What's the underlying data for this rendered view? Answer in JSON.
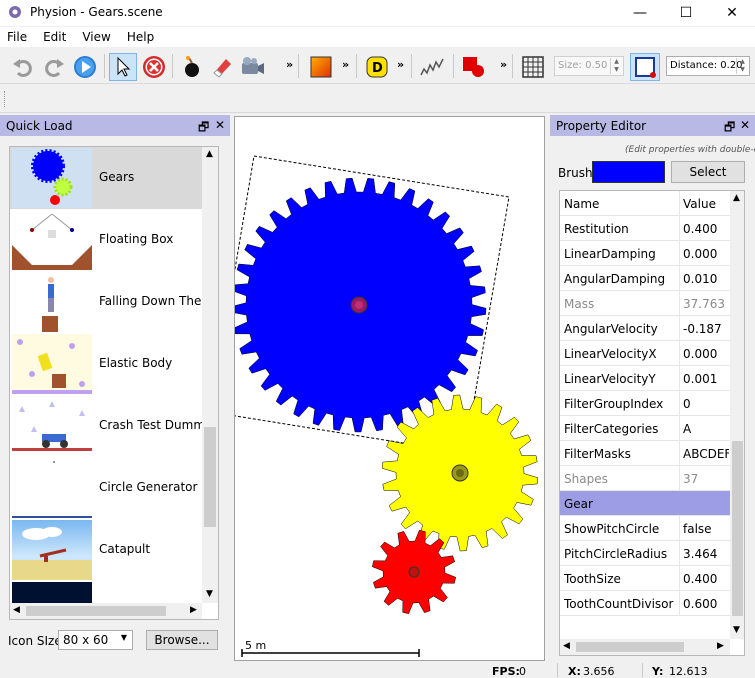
{
  "window": {
    "title": "Physion - Gears.scene",
    "minimize": "—",
    "maximize": "☐",
    "close": "✕"
  },
  "menu": [
    "File",
    "Edit",
    "View",
    "Help"
  ],
  "toolbar": {
    "size_label": "Size: 0.50",
    "distance_label": "Distance: 0.20",
    "chevron": "»"
  },
  "quick_load": {
    "title": "Quick Load",
    "float": "🗗",
    "close": "✕",
    "items": [
      {
        "label": "Gears",
        "selected": true
      },
      {
        "label": "Floating Box"
      },
      {
        "label": "Falling Down The St"
      },
      {
        "label": "Elastic Body"
      },
      {
        "label": "Crash Test Dummy"
      },
      {
        "label": "Circle Generator"
      },
      {
        "label": "Catapult"
      }
    ],
    "icon_size_label": "Icon SIze",
    "icon_size_value": "80 x 60",
    "browse_label": "Browse..."
  },
  "scene": {
    "scale_label": "5 m"
  },
  "property_editor": {
    "title": "Property Editor",
    "hint": "(Edit properties with double-click)",
    "brush_label": "Brush",
    "brush_color": "#0000ff",
    "select_label": "Select",
    "col_name": "Name",
    "col_value": "Value",
    "rows": [
      {
        "name": "Restitution",
        "value": "0.400"
      },
      {
        "name": "LinearDamping",
        "value": "0.000"
      },
      {
        "name": "AngularDamping",
        "value": "0.010"
      },
      {
        "name": "Mass",
        "value": "37.763",
        "readonly": true
      },
      {
        "name": "AngularVelocity",
        "value": "-0.187"
      },
      {
        "name": "LinearVelocityX",
        "value": "0.000"
      },
      {
        "name": "LinearVelocityY",
        "value": "0.001"
      },
      {
        "name": "FilterGroupIndex",
        "value": "0"
      },
      {
        "name": "FilterCategories",
        "value": "A"
      },
      {
        "name": "FilterMasks",
        "value": "ABCDEFGH"
      },
      {
        "name": "Shapes",
        "value": "37",
        "readonly": true
      },
      {
        "name": "Gear",
        "value": "",
        "group": true
      },
      {
        "name": "ShowPitchCircle",
        "value": "false"
      },
      {
        "name": "PitchCircleRadius",
        "value": "3.464"
      },
      {
        "name": "ToothSize",
        "value": "0.400"
      },
      {
        "name": "ToothCountDivisor",
        "value": "0.600"
      }
    ]
  },
  "status": {
    "fps_label": "FPS:",
    "fps_value": "0",
    "x_label": "X:",
    "x_value": "3.656",
    "y_label": "Y:",
    "y_value": "12.613"
  },
  "colors": {
    "gear_large": "#0000ff",
    "gear_medium": "#ffff00",
    "gear_small": "#ff0000",
    "panel_header": "#b9b9e6",
    "group_row": "#9d9de6"
  },
  "icons": [
    "undo-icon",
    "redo-icon",
    "play-icon",
    "pointer-icon",
    "stop-icon",
    "bomb-icon",
    "eraser-icon",
    "camera-icon",
    "box-tool-icon",
    "d-tool-icon",
    "spring-icon",
    "polygon-tool-icon",
    "grid-icon",
    "snap-icon"
  ]
}
